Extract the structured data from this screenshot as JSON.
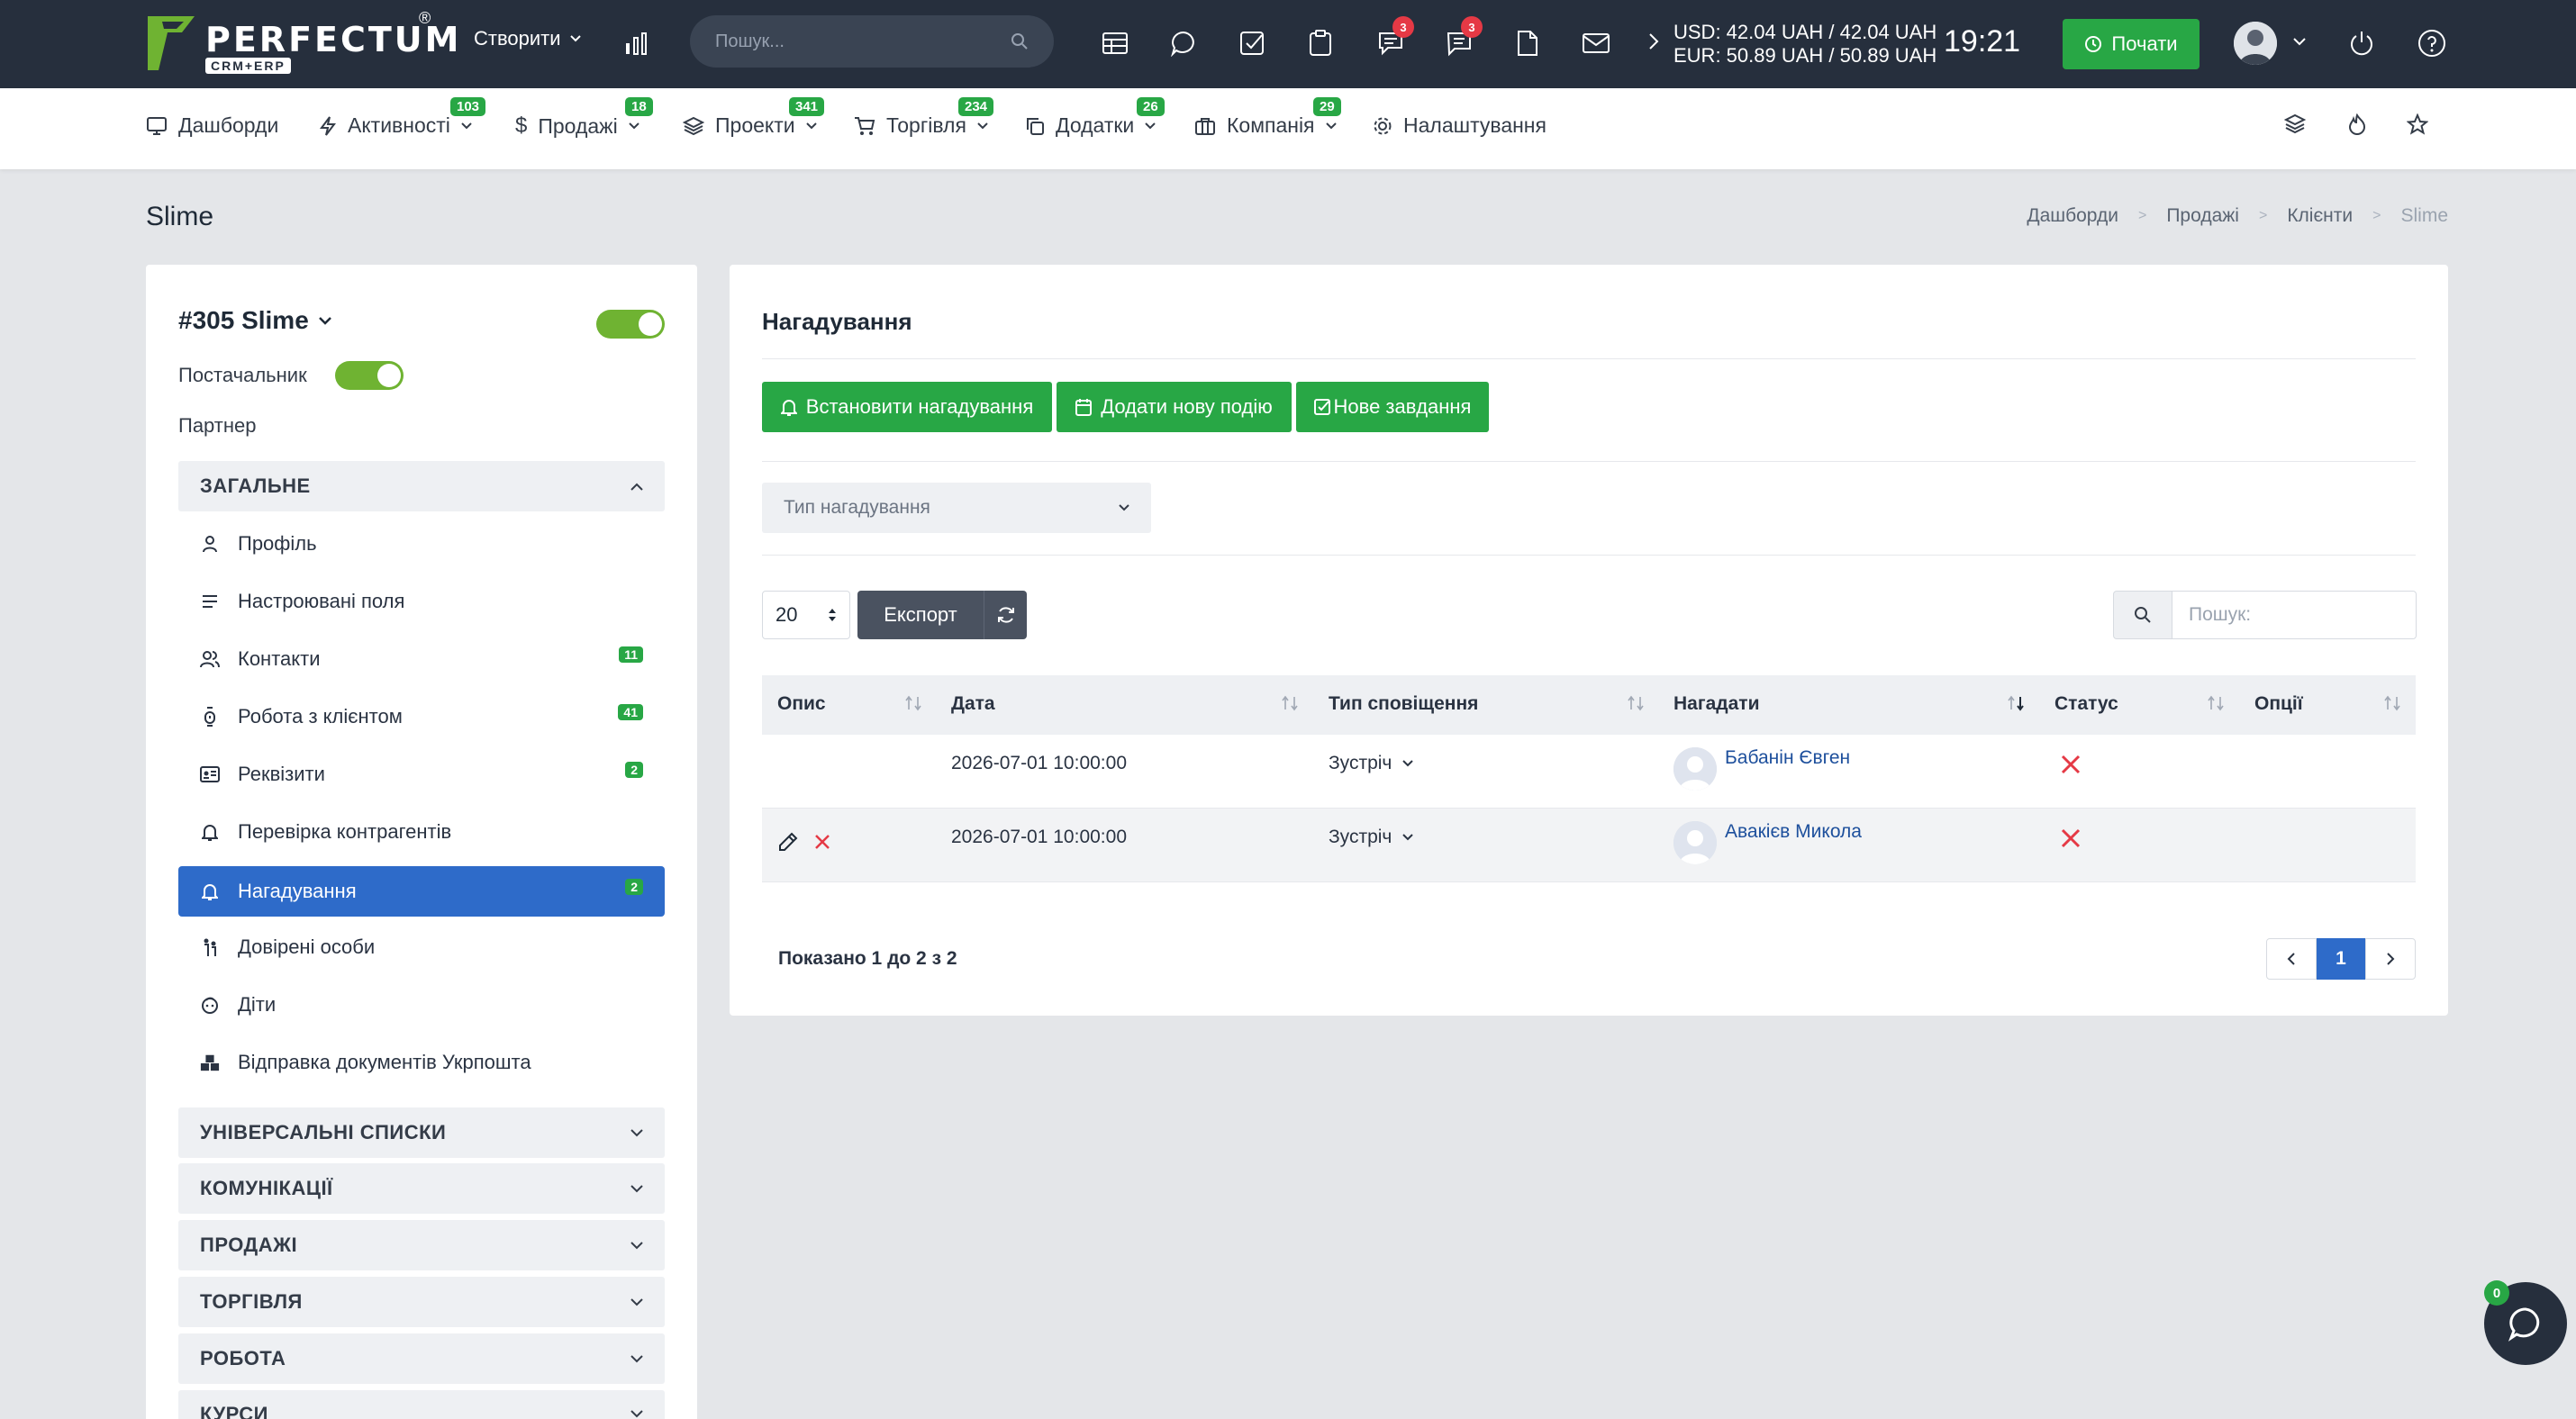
{
  "topbar": {
    "brand": "PERFECTUM",
    "brand_reg": "®",
    "brand_sub": "CRM+ERP",
    "create_label": "Створити",
    "search_placeholder": "Пошук...",
    "chat_badge": "3",
    "messages_badge": "3",
    "rate_usd": "USD: 42.04 UAH / 42.04 UAH",
    "rate_eur": "EUR: 50.89 UAH / 50.89 UAH",
    "clock": "19:21",
    "start_label": "Почати"
  },
  "menu": {
    "items": [
      {
        "label": "Дашборди",
        "badge": ""
      },
      {
        "label": "Активності",
        "badge": "103"
      },
      {
        "label": "Продажі",
        "badge": "18"
      },
      {
        "label": "Проекти",
        "badge": "341"
      },
      {
        "label": "Торгівля",
        "badge": "234"
      },
      {
        "label": "Додатки",
        "badge": "26"
      },
      {
        "label": "Компанія",
        "badge": "29"
      },
      {
        "label": "Налаштування",
        "badge": ""
      }
    ]
  },
  "page": {
    "title": "Slime",
    "breadcrumb": [
      "Дашборди",
      "Продажі",
      "Клієнти",
      "Slime"
    ]
  },
  "client": {
    "name": "#305 Slime",
    "supplier_label": "Постачальник",
    "partner_label": "Партнер",
    "section_general": "ЗАГАЛЬНЕ",
    "items": [
      {
        "label": "Профіль",
        "badge": "",
        "icon": "user-icon"
      },
      {
        "label": "Настроювані поля",
        "badge": "",
        "icon": "lines-icon"
      },
      {
        "label": "Контакти",
        "badge": "11",
        "icon": "users-icon"
      },
      {
        "label": "Робота з клієнтом",
        "badge": "41",
        "icon": "handshake-icon"
      },
      {
        "label": "Реквізити",
        "badge": "2",
        "icon": "id-card-icon"
      },
      {
        "label": "Перевірка контрагентів",
        "badge": "",
        "icon": "bell-icon"
      },
      {
        "label": "Нагадування",
        "badge": "2",
        "icon": "bell-icon"
      },
      {
        "label": "Довірені особи",
        "badge": "",
        "icon": "people-icon"
      },
      {
        "label": "Діти",
        "badge": "",
        "icon": "child-icon"
      },
      {
        "label": "Відправка документів Укрпошта",
        "badge": "",
        "icon": "boxes-icon"
      }
    ],
    "sections": [
      "УНІВЕРСАЛЬНІ СПИСКИ",
      "КОМУНІКАЦІЇ",
      "ПРОДАЖІ",
      "ТОРГІВЛЯ",
      "РОБОТА",
      "КУРСИ"
    ]
  },
  "reminders": {
    "title": "Нагадування",
    "btn_set": "Встановити нагадування",
    "btn_event": "Додати нову подію",
    "btn_task": "Нове завдання",
    "type_placeholder": "Тип нагадування",
    "page_length": "20",
    "export_label": "Експорт",
    "search_placeholder": "Пошук:",
    "columns": [
      "Опис",
      "Дата",
      "Тип сповіщення",
      "Нагадати",
      "Статус",
      "Опції"
    ],
    "rows": [
      {
        "date": "2026-07-01 10:00:00",
        "type": "Зустріч",
        "user": "Бабанін Євген"
      },
      {
        "date": "2026-07-01 10:00:00",
        "type": "Зустріч",
        "user": "Авакієв Микола"
      }
    ],
    "info": "Показано 1 до 2 з 2",
    "current_page": "1"
  },
  "chat": {
    "badge": "0"
  },
  "colors": {
    "topbar": "#262f3d",
    "green": "#28a745",
    "active_blue": "#2e6bc9",
    "danger": "#e53945"
  }
}
